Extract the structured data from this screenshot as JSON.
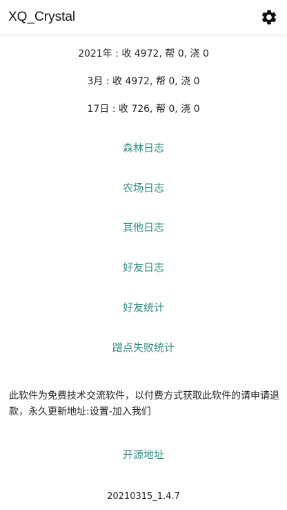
{
  "appbar": {
    "title": "XQ_Crystal",
    "settings_icon": "gear-icon"
  },
  "stats": {
    "year": "2021年 : 收 4972,  帮 0,  浇 0",
    "month": "3月 : 收 4972,  帮 0,  浇 0",
    "day": "17日 : 收 726,  帮 0,  浇 0"
  },
  "links": {
    "forest_log": "森林日志",
    "farm_log": "农场日志",
    "other_log": "其他日志",
    "friend_log": "好友日志",
    "friend_stats": "好友统计",
    "steal_fail_stats": "蹭点失败统计"
  },
  "notice": "此软件为免费技术交流软件，以付费方式获取此软件的请申请退款，永久更新地址:设置-加入我们",
  "open_source_link": "开源地址",
  "version": "20210315_1.4.7",
  "colors": {
    "accent": "#2f8f86",
    "text": "#222222",
    "background": "#ffffff"
  }
}
